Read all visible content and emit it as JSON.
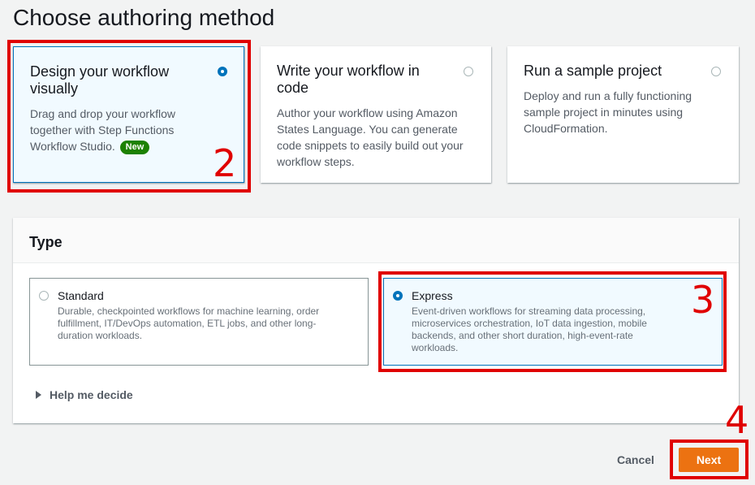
{
  "page": {
    "title": "Choose authoring method"
  },
  "methods": [
    {
      "title": "Design your workflow visually",
      "description": "Drag and drop your workflow together with Step Functions Workflow Studio.",
      "badge": "New",
      "selected": true
    },
    {
      "title": "Write your workflow in code",
      "description": "Author your workflow using Amazon States Language. You can generate code snippets to easily build out your workflow steps.",
      "selected": false
    },
    {
      "title": "Run a sample project",
      "description": "Deploy and run a fully functioning sample project in minutes using CloudFormation.",
      "selected": false
    }
  ],
  "type_section": {
    "title": "Type",
    "options": [
      {
        "label": "Standard",
        "description": "Durable, checkpointed workflows for machine learning, order fulfillment, IT/DevOps automation, ETL jobs, and other long-duration workloads.",
        "selected": false
      },
      {
        "label": "Express",
        "description": "Event-driven workflows for streaming data processing, microservices orchestration, IoT data ingestion, mobile backends, and other short duration, high-event-rate workloads.",
        "selected": true
      }
    ],
    "help_label": "Help me decide"
  },
  "actions": {
    "cancel_label": "Cancel",
    "next_label": "Next"
  },
  "annotations": {
    "step2": "2",
    "step3": "3",
    "step4": "4"
  },
  "colors": {
    "primary": "#0073bb",
    "next_button": "#ec7211",
    "badge": "#1d8102",
    "annotation": "#e00000"
  }
}
